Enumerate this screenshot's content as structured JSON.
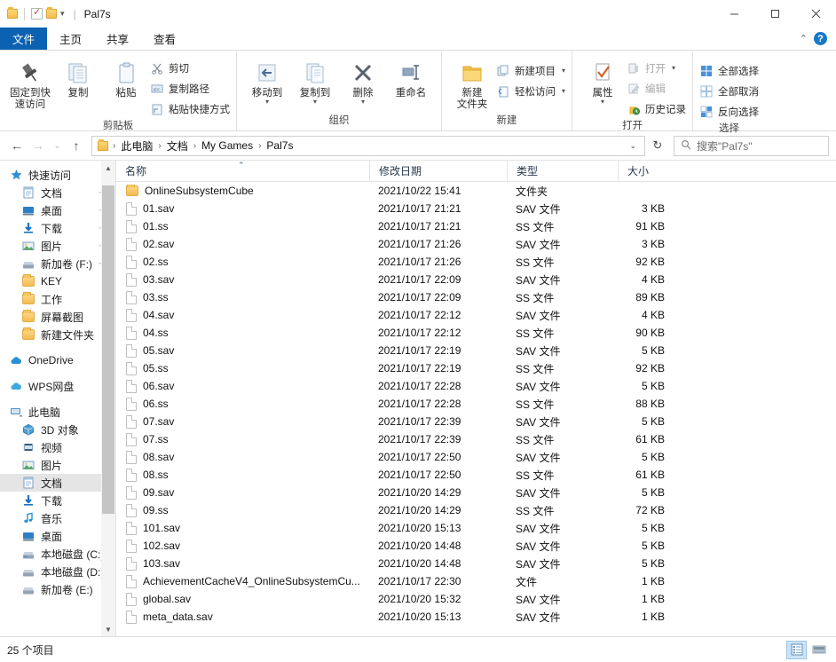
{
  "titlebar": {
    "app_title": "Pal7s",
    "qat": [
      {
        "name": "folder-properties-icon",
        "label": "属性"
      },
      {
        "name": "checkbox-icon",
        "label": "选择"
      },
      {
        "name": "new-folder-icon",
        "label": "新建文件夹"
      }
    ],
    "customize_caret": "▾",
    "minimize": "–",
    "maximize": "□",
    "close": "✕"
  },
  "tabs": [
    {
      "id": "file",
      "label": "文件"
    },
    {
      "id": "home",
      "label": "主页"
    },
    {
      "id": "share",
      "label": "共享"
    },
    {
      "id": "view",
      "label": "查看"
    }
  ],
  "ribbon_right": {
    "collapse": "⌃",
    "help": "?"
  },
  "ribbon": {
    "clipboard": {
      "label": "剪贴板",
      "pin": "固定到快\n速访问",
      "pin_line1": "固定到快",
      "pin_line2": "速访问",
      "copy": "复制",
      "paste": "粘贴",
      "cut": "剪切",
      "copy_path": "复制路径",
      "paste_shortcut": "粘贴快捷方式"
    },
    "organize": {
      "label": "组织",
      "move_to": "移动到",
      "copy_to": "复制到",
      "delete": "删除",
      "rename": "重命名"
    },
    "new": {
      "label": "新建",
      "new_folder_line1": "新建",
      "new_folder_line2": "文件夹",
      "new_item": "新建项目",
      "easy_access": "轻松访问"
    },
    "open": {
      "label": "打开",
      "properties": "属性",
      "open": "打开",
      "edit": "编辑",
      "history": "历史记录"
    },
    "select": {
      "label": "选择",
      "select_all": "全部选择",
      "select_none": "全部取消",
      "invert": "反向选择"
    }
  },
  "addressbar": {
    "back": "←",
    "forward": "→",
    "recent": "⌄",
    "up": "↑",
    "breadcrumbs": [
      "此电脑",
      "文档",
      "My Games",
      "Pal7s"
    ],
    "separator": "›",
    "dropdown": "⌄",
    "refresh": "↻",
    "search_placeholder": "搜索\"Pal7s\"",
    "search_value": ""
  },
  "sidebar": {
    "groups": [
      {
        "header": {
          "label": "快速访问",
          "icon": "star-pin-icon"
        },
        "items": [
          {
            "label": "文档",
            "icon": "documents-icon",
            "pinned": true
          },
          {
            "label": "桌面",
            "icon": "desktop-icon",
            "pinned": true
          },
          {
            "label": "下载",
            "icon": "downloads-icon",
            "pinned": true
          },
          {
            "label": "图片",
            "icon": "pictures-icon",
            "pinned": true
          },
          {
            "label": "新加卷 (F:)",
            "icon": "drive-icon",
            "pinned": true
          },
          {
            "label": "KEY",
            "icon": "folder-icon",
            "pinned": false
          },
          {
            "label": "工作",
            "icon": "folder-icon",
            "pinned": false
          },
          {
            "label": "屏幕截图",
            "icon": "folder-icon",
            "pinned": false
          },
          {
            "label": "新建文件夹",
            "icon": "folder-icon",
            "pinned": false
          }
        ]
      },
      {
        "header": {
          "label": "OneDrive",
          "icon": "onedrive-cloud-icon"
        },
        "items": []
      },
      {
        "header": {
          "label": "WPS网盘",
          "icon": "wps-cloud-icon"
        },
        "items": []
      },
      {
        "header": {
          "label": "此电脑",
          "icon": "this-pc-icon"
        },
        "items": [
          {
            "label": "3D 对象",
            "icon": "3d-objects-icon",
            "pinned": false
          },
          {
            "label": "视频",
            "icon": "videos-icon",
            "pinned": false
          },
          {
            "label": "图片",
            "icon": "pictures-icon",
            "pinned": false
          },
          {
            "label": "文档",
            "icon": "documents-icon",
            "pinned": false,
            "selected": true
          },
          {
            "label": "下载",
            "icon": "downloads-icon",
            "pinned": false
          },
          {
            "label": "音乐",
            "icon": "music-icon",
            "pinned": false
          },
          {
            "label": "桌面",
            "icon": "desktop-icon",
            "pinned": false
          },
          {
            "label": "本地磁盘 (C:)",
            "icon": "hard-drive-icon",
            "pinned": false
          },
          {
            "label": "本地磁盘 (D:)",
            "icon": "drive-icon",
            "pinned": false
          },
          {
            "label": "新加卷 (E:)",
            "icon": "drive-icon",
            "pinned": false
          }
        ]
      }
    ]
  },
  "filelist": {
    "columns": [
      {
        "key": "name",
        "label": "名称",
        "sorted": "asc"
      },
      {
        "key": "date",
        "label": "修改日期"
      },
      {
        "key": "type",
        "label": "类型"
      },
      {
        "key": "size",
        "label": "大小"
      }
    ],
    "sort_caret": "⌃",
    "rows": [
      {
        "name": "OnlineSubsystemCube",
        "date": "2021/10/22 15:41",
        "type": "文件夹",
        "size": "",
        "icon": "folder-icon"
      },
      {
        "name": "01.sav",
        "date": "2021/10/17 21:21",
        "type": "SAV 文件",
        "size": "3 KB",
        "icon": "file-icon"
      },
      {
        "name": "01.ss",
        "date": "2021/10/17 21:21",
        "type": "SS 文件",
        "size": "91 KB",
        "icon": "file-icon"
      },
      {
        "name": "02.sav",
        "date": "2021/10/17 21:26",
        "type": "SAV 文件",
        "size": "3 KB",
        "icon": "file-icon"
      },
      {
        "name": "02.ss",
        "date": "2021/10/17 21:26",
        "type": "SS 文件",
        "size": "92 KB",
        "icon": "file-icon"
      },
      {
        "name": "03.sav",
        "date": "2021/10/17 22:09",
        "type": "SAV 文件",
        "size": "4 KB",
        "icon": "file-icon"
      },
      {
        "name": "03.ss",
        "date": "2021/10/17 22:09",
        "type": "SS 文件",
        "size": "89 KB",
        "icon": "file-icon"
      },
      {
        "name": "04.sav",
        "date": "2021/10/17 22:12",
        "type": "SAV 文件",
        "size": "4 KB",
        "icon": "file-icon"
      },
      {
        "name": "04.ss",
        "date": "2021/10/17 22:12",
        "type": "SS 文件",
        "size": "90 KB",
        "icon": "file-icon"
      },
      {
        "name": "05.sav",
        "date": "2021/10/17 22:19",
        "type": "SAV 文件",
        "size": "5 KB",
        "icon": "file-icon"
      },
      {
        "name": "05.ss",
        "date": "2021/10/17 22:19",
        "type": "SS 文件",
        "size": "92 KB",
        "icon": "file-icon"
      },
      {
        "name": "06.sav",
        "date": "2021/10/17 22:28",
        "type": "SAV 文件",
        "size": "5 KB",
        "icon": "file-icon"
      },
      {
        "name": "06.ss",
        "date": "2021/10/17 22:28",
        "type": "SS 文件",
        "size": "88 KB",
        "icon": "file-icon"
      },
      {
        "name": "07.sav",
        "date": "2021/10/17 22:39",
        "type": "SAV 文件",
        "size": "5 KB",
        "icon": "file-icon"
      },
      {
        "name": "07.ss",
        "date": "2021/10/17 22:39",
        "type": "SS 文件",
        "size": "61 KB",
        "icon": "file-icon"
      },
      {
        "name": "08.sav",
        "date": "2021/10/17 22:50",
        "type": "SAV 文件",
        "size": "5 KB",
        "icon": "file-icon"
      },
      {
        "name": "08.ss",
        "date": "2021/10/17 22:50",
        "type": "SS 文件",
        "size": "61 KB",
        "icon": "file-icon"
      },
      {
        "name": "09.sav",
        "date": "2021/10/20 14:29",
        "type": "SAV 文件",
        "size": "5 KB",
        "icon": "file-icon"
      },
      {
        "name": "09.ss",
        "date": "2021/10/20 14:29",
        "type": "SS 文件",
        "size": "72 KB",
        "icon": "file-icon"
      },
      {
        "name": "101.sav",
        "date": "2021/10/20 15:13",
        "type": "SAV 文件",
        "size": "5 KB",
        "icon": "file-icon"
      },
      {
        "name": "102.sav",
        "date": "2021/10/20 14:48",
        "type": "SAV 文件",
        "size": "5 KB",
        "icon": "file-icon"
      },
      {
        "name": "103.sav",
        "date": "2021/10/20 14:48",
        "type": "SAV 文件",
        "size": "5 KB",
        "icon": "file-icon"
      },
      {
        "name": "AchievementCacheV4_OnlineSubsystemCu...",
        "date": "2021/10/17 22:30",
        "type": "文件",
        "size": "1 KB",
        "icon": "file-icon"
      },
      {
        "name": "global.sav",
        "date": "2021/10/20 15:32",
        "type": "SAV 文件",
        "size": "1 KB",
        "icon": "file-icon"
      },
      {
        "name": "meta_data.sav",
        "date": "2021/10/20 15:13",
        "type": "SAV 文件",
        "size": "1 KB",
        "icon": "file-icon"
      }
    ]
  },
  "statusbar": {
    "item_count": "25 个项目",
    "views": [
      {
        "name": "details-view",
        "selected": true
      },
      {
        "name": "large-icons-view",
        "selected": false
      }
    ]
  }
}
